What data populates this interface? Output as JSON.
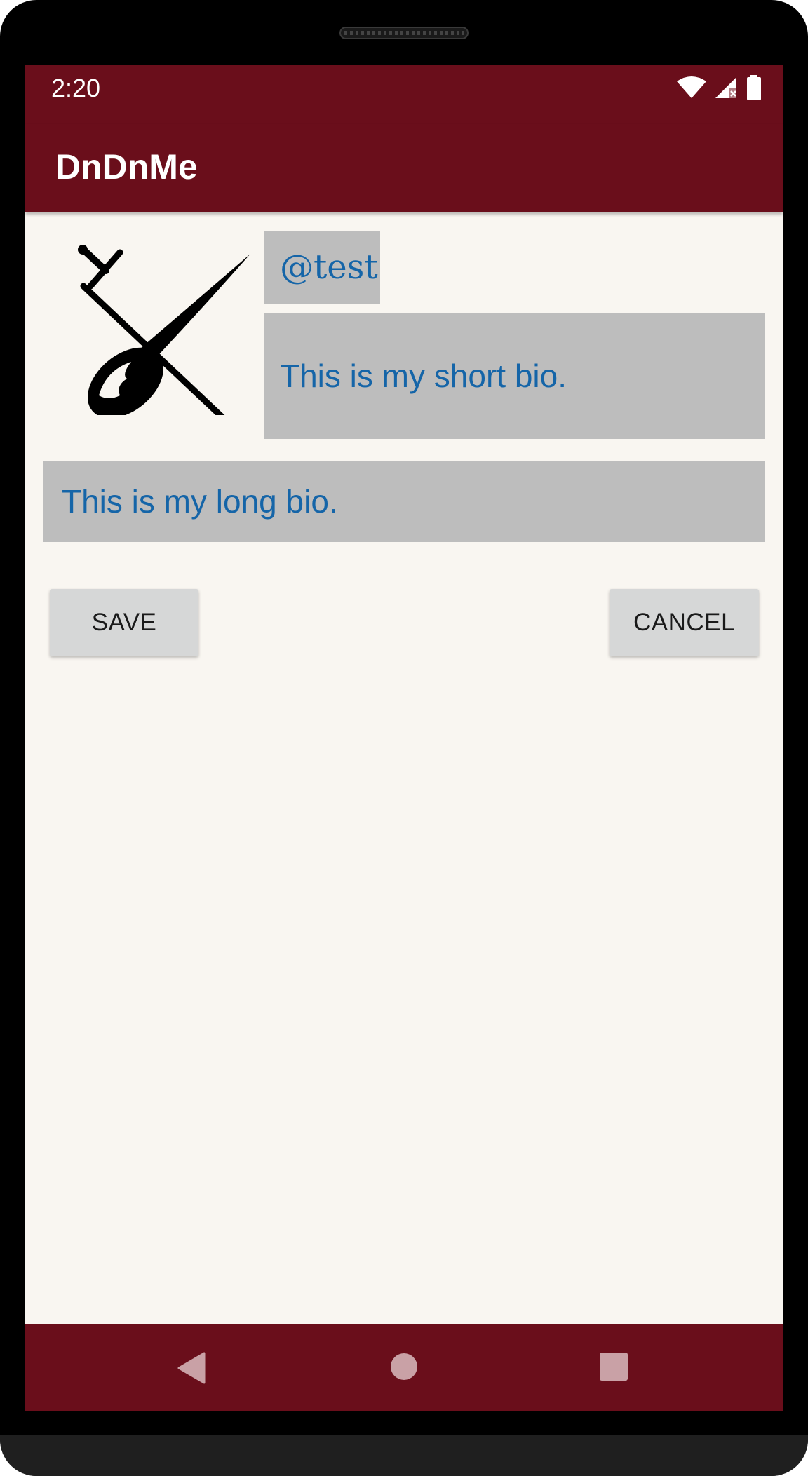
{
  "status_bar": {
    "time": "2:20",
    "icons": [
      "wifi-icon",
      "cellular-signal-icon",
      "battery-icon"
    ]
  },
  "app_bar": {
    "title": "DnDnMe"
  },
  "profile": {
    "avatar_icon": "sword-comet-logo",
    "username": "@test",
    "short_bio": "This is my short bio.",
    "long_bio": "This is my long bio."
  },
  "actions": {
    "save_label": "SAVE",
    "cancel_label": "CANCEL"
  },
  "nav_bar": {
    "icons": [
      "back-icon",
      "home-icon",
      "recents-icon"
    ]
  },
  "colors": {
    "primary": "#6a0e1b",
    "background": "#f9f6f1",
    "field_background": "#bdbdbd",
    "field_text": "#1565a8",
    "button_background": "#d6d7d7"
  }
}
